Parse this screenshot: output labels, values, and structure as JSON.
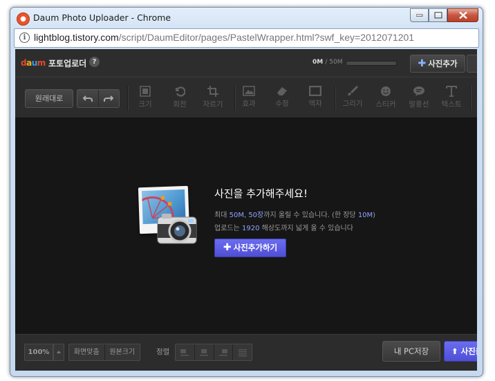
{
  "window": {
    "title": "Daum Photo Uploader - Chrome",
    "app_icon": "chrome-app-icon",
    "buttons": [
      "minimize",
      "maximize",
      "close"
    ]
  },
  "address_bar": {
    "host": "lightblog.tistory.com",
    "path": "/script/DaumEditor/pages/PastelWrapper.html?swf_key=2012071201"
  },
  "header": {
    "logo_letters": [
      "d",
      "a",
      "u",
      "m"
    ],
    "logo_colors": [
      "#e44a2a",
      "#f2b51c",
      "#3a9de8",
      "#e44a2a"
    ],
    "title": "포토업로더",
    "help": "?",
    "used": "0M",
    "total": "/ 50M",
    "usage_fraction": 0,
    "add_photo": "사진추가"
  },
  "toolbar": {
    "original": "원래대로",
    "tools": [
      "크기",
      "회전",
      "자르기",
      "효과",
      "수정",
      "액자",
      "그리기",
      "스티커",
      "말풍선",
      "텍스트"
    ]
  },
  "empty_state": {
    "title": "사진을 추가해주세요!",
    "line1": {
      "prefix": "최대 ",
      "max_size": "50M",
      "comma": ", ",
      "max_count": "50장",
      "mid": "까지 올릴 수 있습니다. (한 장당 ",
      "per_photo": "10M",
      "suffix": ")"
    },
    "line2": {
      "prefix": "업로드는 ",
      "resolution": "1920",
      "suffix": " 해상도까지 넓게 올 수 있습니다"
    },
    "add_button": "사진추가하기"
  },
  "footer": {
    "zoom": "100%",
    "fit_screen": "화면맞춤",
    "original_size": "원본크기",
    "align_label": "정렬",
    "save_pc": "내 PC저장",
    "upload": "사진올리기"
  },
  "colors": {
    "accent": "#5b5ce6",
    "highlight": "#8fa5ff"
  }
}
